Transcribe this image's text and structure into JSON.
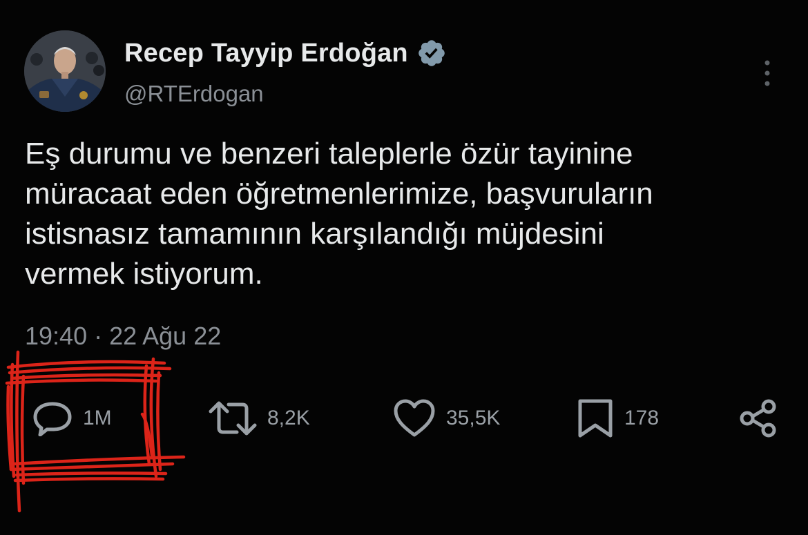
{
  "tweet": {
    "author": {
      "display_name": "Recep Tayyip Erdoğan",
      "handle": "@RTErdogan",
      "verified_icon": "verified-badge-icon",
      "avatar": "profile-photo"
    },
    "text": "Eş durumu ve benzeri taleplerle özür tayinine\nmüracaat eden öğretmenlerimize, başvuruların\nistisnasız tamamının karşılandığı müjdesini\nvermek istiyorum.",
    "timestamp": "19:40 · 22 Ağu 22",
    "actions": {
      "reply": {
        "icon": "reply-icon",
        "count": "1M"
      },
      "retweet": {
        "icon": "retweet-icon",
        "count": "8,2K"
      },
      "like": {
        "icon": "heart-icon",
        "count": "35,5K"
      },
      "bookmark": {
        "icon": "bookmark-icon",
        "count": "178"
      },
      "share": {
        "icon": "share-icon"
      }
    },
    "more_icon": "more-vertical-icon"
  },
  "colors": {
    "background": "#040404",
    "text": "#e7e9ea",
    "muted": "#8b9096",
    "verified_badge": "#829aab",
    "annotation": "#e8261b"
  }
}
